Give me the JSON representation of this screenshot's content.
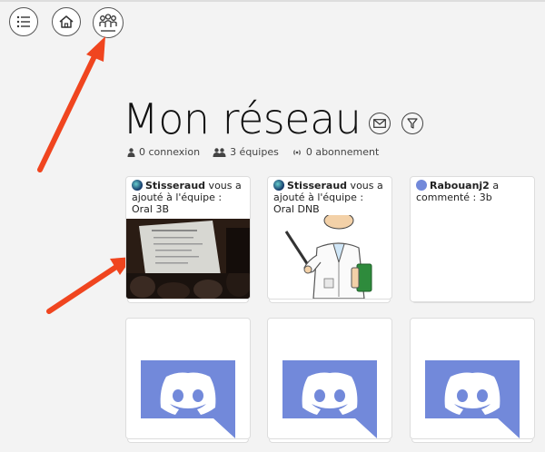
{
  "page": {
    "title": "Mon réseau"
  },
  "topnav": {
    "icons": [
      "list-icon",
      "home-icon",
      "network-icon"
    ]
  },
  "stats": {
    "connections": "0 connexion",
    "teams": "3 équipes",
    "subscriptions": "0 abonnement"
  },
  "cards": [
    {
      "user": "Stisseraud",
      "text": " vous a ajouté à l'équipe : Oral 3B"
    },
    {
      "user": "Stisseraud",
      "text": " vous a ajouté à l'équipe : Oral DNB"
    },
    {
      "user": "Rabouanj2",
      "text": " a commenté : 3b"
    }
  ],
  "colors": {
    "arrow": "#f0451f",
    "discord": "#7289da"
  }
}
